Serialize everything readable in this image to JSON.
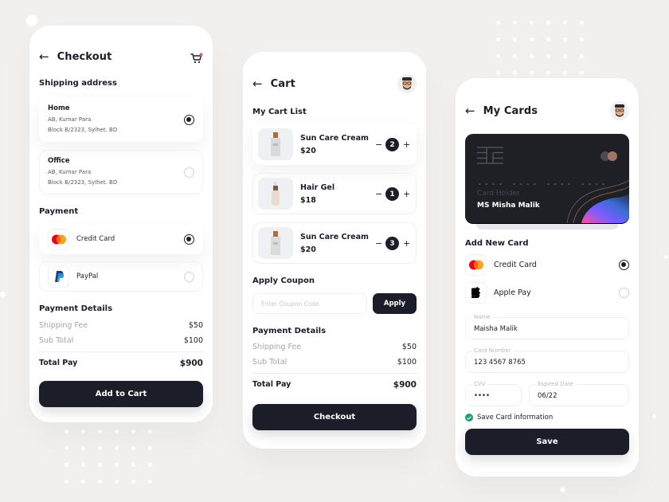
{
  "colors": {
    "background": "#f1f0ee",
    "dark": "#1b1e28",
    "muted_text": "#a3a6ad",
    "success": "#1e9e6a",
    "cart_badge": "#ff4b8a"
  },
  "checkout": {
    "title": "Checkout",
    "back_icon": "arrow-left-icon",
    "cart_icon": "cart-icon",
    "shipping_title": "Shipping address",
    "addresses": [
      {
        "name": "Home",
        "line1": "AB, Kumar Para",
        "line2": "Block B/2323, Sylhet. BD",
        "selected": true
      },
      {
        "name": "Office",
        "line1": "AB, Kumar Para",
        "line2": "Block B/2323, Sylhet. BD",
        "selected": false
      }
    ],
    "payment_title": "Payment",
    "payment_methods": [
      {
        "label": "Credit Card",
        "icon": "mastercard-icon",
        "selected": true
      },
      {
        "label": "PayPal",
        "icon": "paypal-icon",
        "selected": false
      }
    ],
    "details_title": "Payment Details",
    "details": [
      {
        "label": "Shipping Fee",
        "value": "$50"
      },
      {
        "label": "Sub Total",
        "value": "$100"
      }
    ],
    "total_label": "Total Pay",
    "total_value": "$900",
    "button_label": "Add to Cart"
  },
  "cart": {
    "title": "Cart",
    "list_title": "My Cart List",
    "items": [
      {
        "name": "Sun Care Cream",
        "price": "$20",
        "qty": "2"
      },
      {
        "name": "Hair Gel",
        "price": "$18",
        "qty": "1"
      },
      {
        "name": "Sun Care Cream",
        "price": "$20",
        "qty": "3"
      }
    ],
    "minus_label": "−",
    "plus_label": "+",
    "coupon_title": "Apply Coupon",
    "coupon_placeholder": "Enter Coupon Code",
    "coupon_button": "Apply",
    "details_title": "Payment Details",
    "details": [
      {
        "label": "Shipping Fee",
        "value": "$50"
      },
      {
        "label": "Sub Total",
        "value": "$100"
      }
    ],
    "total_label": "Total Pay",
    "total_value": "$900",
    "button_label": "Checkout"
  },
  "cards": {
    "title": "My Cards",
    "card": {
      "number_mask": "---- ---- ---- ----",
      "holder_label": "Card Holder",
      "holder_name": "MS Misha Malik"
    },
    "add_title": "Add New Card",
    "options": [
      {
        "label": "Credit Card",
        "icon": "mastercard-icon",
        "selected": true
      },
      {
        "label": "Apple Pay",
        "icon": "apple-icon",
        "selected": false
      }
    ],
    "fields": {
      "name_label": "Name",
      "name_value": "Maisha Malik",
      "number_label": "Card Number",
      "number_value": "123 4567 8765",
      "cvv_label": "CVV",
      "cvv_value": "••••",
      "expiry_label": "Espired Date",
      "expiry_value": "06/22"
    },
    "save_info_label": "Save Card information",
    "save_info_checked": true,
    "button_label": "Save"
  }
}
